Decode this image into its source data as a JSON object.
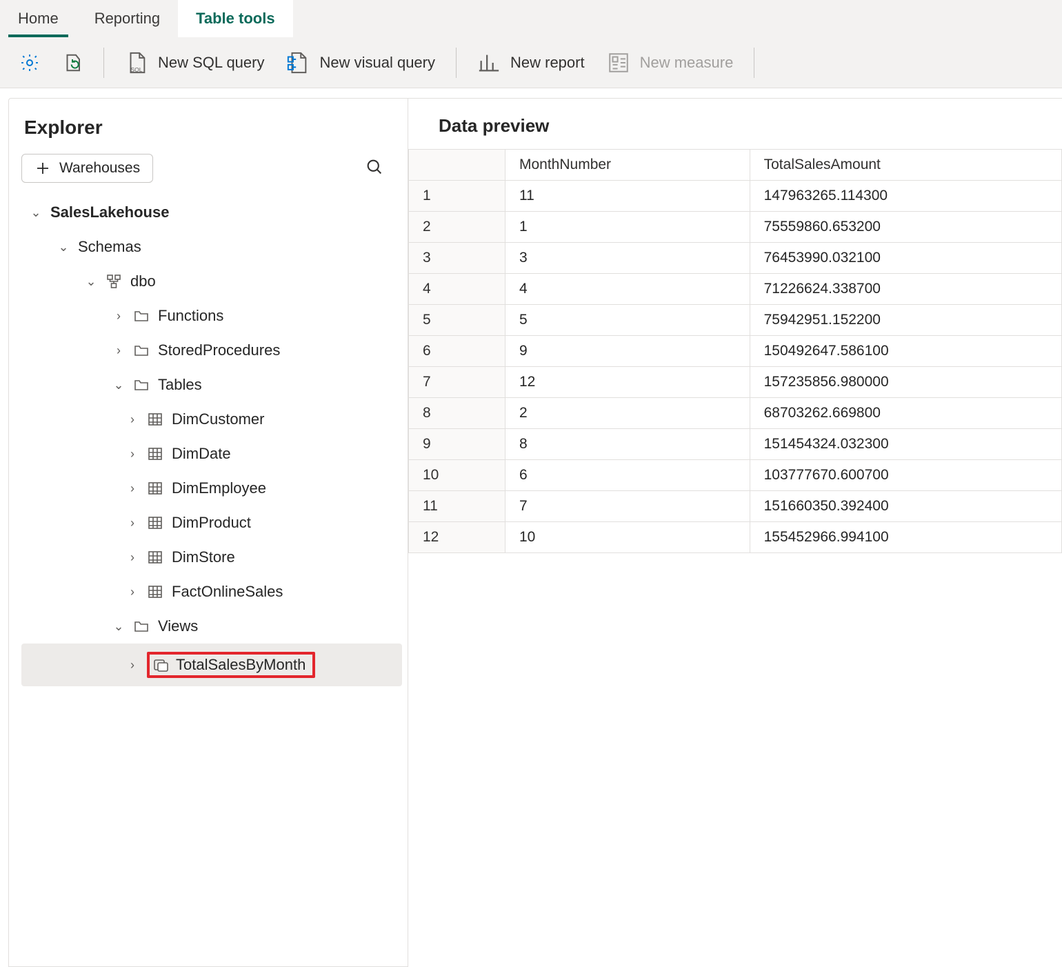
{
  "tabs": {
    "home": "Home",
    "reporting": "Reporting",
    "tableTools": "Table tools"
  },
  "toolbar": {
    "newSql": "New SQL query",
    "newVisual": "New visual query",
    "newReport": "New report",
    "newMeasure": "New measure"
  },
  "explorer": {
    "title": "Explorer",
    "warehouses": "Warehouses",
    "db": "SalesLakehouse",
    "schemas": "Schemas",
    "schemaName": "dbo",
    "functions": "Functions",
    "storedProcs": "StoredProcedures",
    "tables": "Tables",
    "tableList": [
      "DimCustomer",
      "DimDate",
      "DimEmployee",
      "DimProduct",
      "DimStore",
      "FactOnlineSales"
    ],
    "views": "Views",
    "viewName": "TotalSalesByMonth"
  },
  "preview": {
    "title": "Data preview",
    "columns": [
      "MonthNumber",
      "TotalSalesAmount"
    ],
    "rows": [
      [
        "11",
        "147963265.114300"
      ],
      [
        "1",
        "75559860.653200"
      ],
      [
        "3",
        "76453990.032100"
      ],
      [
        "4",
        "71226624.338700"
      ],
      [
        "5",
        "75942951.152200"
      ],
      [
        "9",
        "150492647.586100"
      ],
      [
        "12",
        "157235856.980000"
      ],
      [
        "2",
        "68703262.669800"
      ],
      [
        "8",
        "151454324.032300"
      ],
      [
        "6",
        "103777670.600700"
      ],
      [
        "7",
        "151660350.392400"
      ],
      [
        "10",
        "155452966.994100"
      ]
    ]
  }
}
